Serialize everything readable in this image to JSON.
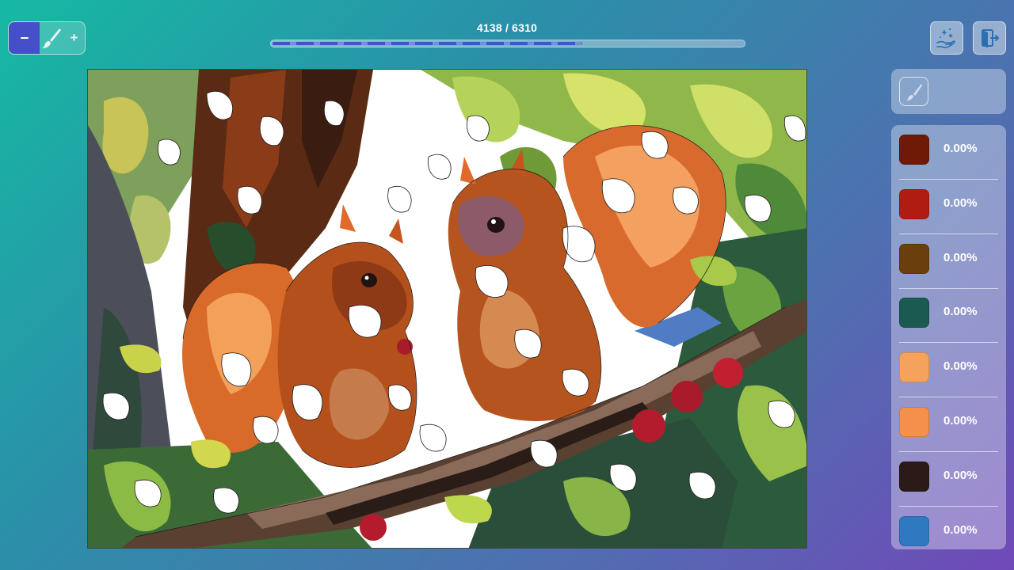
{
  "brush": {
    "minus_label": "−",
    "plus_label": "+",
    "brush_icon": "paintbrush-icon"
  },
  "progress": {
    "text": "4138 / 6310",
    "filled": 4138,
    "total": 6310
  },
  "top_buttons": {
    "hint_icon": "magic-hand-icon",
    "exit_icon": "exit-door-icon"
  },
  "tool": {
    "icon": "paintbrush-icon"
  },
  "palette": [
    {
      "color": "#6e1a06",
      "percent": "0.00%"
    },
    {
      "color": "#b11c12",
      "percent": "0.00%"
    },
    {
      "color": "#6b3f0c",
      "percent": "0.00%"
    },
    {
      "color": "#1b5a50",
      "percent": "0.00%"
    },
    {
      "color": "#f5a35c",
      "percent": "0.00%"
    },
    {
      "color": "#f4904b",
      "percent": "0.00%"
    },
    {
      "color": "#2b1a17",
      "percent": "0.00%"
    },
    {
      "color": "#2e79c0",
      "percent": "0.00%"
    }
  ]
}
